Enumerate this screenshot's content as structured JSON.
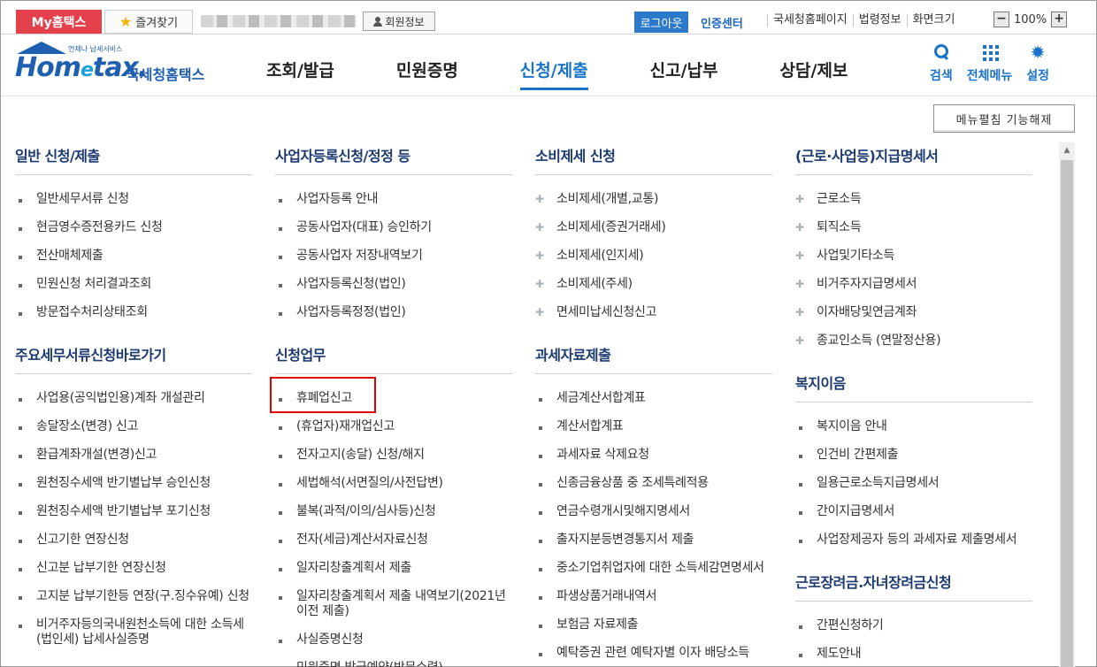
{
  "topbar": {
    "my_hometax": "My홈택스",
    "favorites": "즐겨찾기",
    "member_info": "회원정보",
    "logout": "로그아웃",
    "cert_center": "인증센터",
    "links": [
      "국세청홈페이지",
      "법령정보",
      "화면크기"
    ],
    "zoom_minus": "−",
    "zoom_value": "100%",
    "zoom_plus": "+"
  },
  "header": {
    "logo_tagline": "언제나 납세서비스",
    "logo_word_a": "Hom",
    "logo_word_e": "e",
    "logo_word_b": "tax.",
    "logo_kr": "국세청홈택스",
    "nav": [
      "조회/발급",
      "민원증명",
      "신청/제출",
      "신고/납부",
      "상담/제보"
    ],
    "active_nav": "신청/제출",
    "icons": [
      {
        "label": "검색",
        "icon": "search-icon"
      },
      {
        "label": "전체메뉴",
        "icon": "grid-icon"
      },
      {
        "label": "설정",
        "icon": "gear-icon"
      }
    ]
  },
  "fold_button": "메뉴펼침 기능해제",
  "columns": [
    {
      "sections": [
        {
          "title": "일반 신청/제출",
          "items": [
            "일반세무서류 신청",
            "현금영수증전용카드 신청",
            "전산매체제출",
            "민원신청 처리결과조회",
            "방문접수처리상태조회"
          ]
        },
        {
          "title": "주요세무서류신청바로가기",
          "items": [
            "사업용(공익법인용)계좌 개설관리",
            "송달장소(변경) 신고",
            "환급계좌개설(변경)신고",
            "원천징수세액 반기별납부 승인신청",
            "원천징수세액 반기별납부 포기신청",
            "신고기한 연장신청",
            "신고분 납부기한 연장신청",
            "고지분 납부기한등 연장(구.징수유예) 신청",
            "비거주자등의국내원천소득에 대한 소득세(법인세) 납세사실증명"
          ]
        }
      ]
    },
    {
      "sections": [
        {
          "title": "사업자등록신청/정정 등",
          "items": [
            "사업자등록 안내",
            "공동사업자(대표) 승인하기",
            "공동사업자 저장내역보기",
            "사업자등록신청(법인)",
            "사업자등록정정(법인)"
          ]
        },
        {
          "title": "신청업무",
          "items": [
            "휴폐업신고",
            "(휴업자)재개업신고",
            "전자고지(송달) 신청/해지",
            "세법해석(서면질의/사전답변)",
            "불복(과적/이의/심사등)신청",
            "전자(세금)계산서자료신청",
            "일자리창출계획서 제출",
            "일자리창출계획서 제출 내역보기(2021년 이전 제출)",
            "사실증명신청",
            "민원증명 발급예약(방문수령)"
          ]
        }
      ]
    },
    {
      "sections": [
        {
          "title": "소비제세 신청",
          "marker": "plus",
          "items": [
            "소비제세(개별,교통)",
            "소비제세(증권거래세)",
            "소비제세(인지세)",
            "소비제세(주세)",
            "면세미납세신청신고"
          ]
        },
        {
          "title": "과세자료제출",
          "items": [
            "세금계산서합계표",
            "계산서합계표",
            "과세자료 삭제요청",
            "신종금융상품 중 조세특례적용",
            "연금수령개시및해지명세서",
            "출자지분등변경통지서 제출",
            "중소기업취업자에 대한 소득세감면명세서",
            "파생상품거래내역서",
            "보험금 자료제출",
            "예탁증권 관련 예탁자별 이자 배당소득"
          ]
        }
      ]
    },
    {
      "sections": [
        {
          "title": "(근로·사업등)지급명세서",
          "marker": "plus",
          "items": [
            "근로소득",
            "퇴직소득",
            "사업및기타소득",
            "비거주자지급명세서",
            "이자배당및연금계좌",
            "종교인소득 (연말정산용)"
          ]
        },
        {
          "title": "복지이음",
          "items": [
            "복지이음 안내",
            "인건비 간편제출",
            "일용근로소득지급명세서",
            "간이지급명세서",
            "사업장제공자 등의 과세자료 제출명세서"
          ]
        },
        {
          "title": "근로장려금.자녀장려금신청",
          "items": [
            "간편신청하기",
            "제도안내"
          ]
        }
      ]
    }
  ],
  "highlighted_item": "휴폐업신고"
}
